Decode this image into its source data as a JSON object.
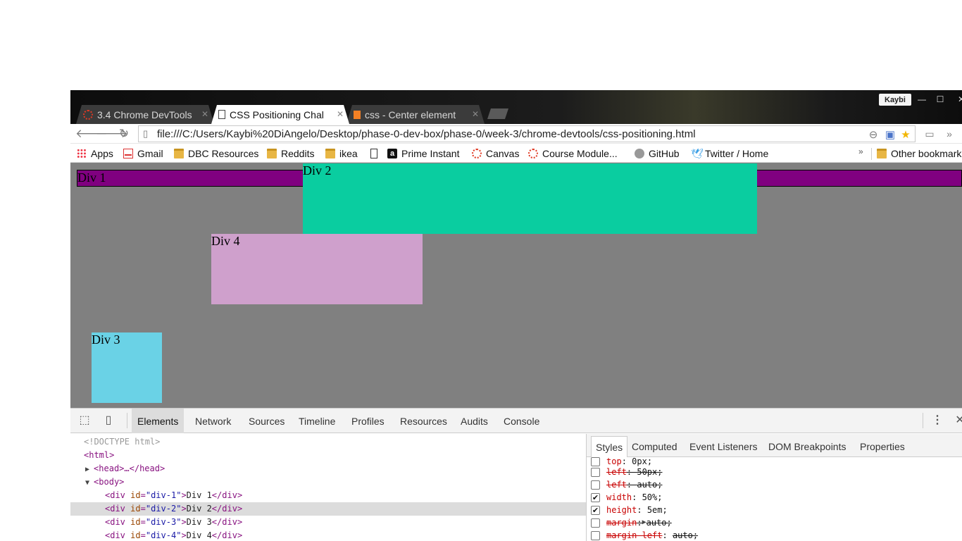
{
  "browser": {
    "tabs": [
      {
        "title": "3.4 Chrome DevTools",
        "icon": "dbc-icon",
        "active": false
      },
      {
        "title": "CSS Positioning Chal",
        "icon": "page-icon",
        "active": true
      },
      {
        "title": "css - Center element",
        "icon": "stackoverflow-icon",
        "active": false
      }
    ],
    "profile_name": "Kaybi",
    "window_controls": {
      "minimize": "—",
      "maximize": "☐",
      "close": "✕"
    },
    "address": {
      "url": "file:///C:/Users/Kaybi%20DiAngelo/Desktop/phase-0-dev-box/phase-0/week-3/chrome-devtools/css-positioning.html"
    },
    "nav": {
      "back": "🡐",
      "forward": "🡒",
      "reload": "↻",
      "more": "»"
    }
  },
  "bookmarks": {
    "items": [
      {
        "label": "Apps",
        "icon": "apps-icon"
      },
      {
        "label": "Gmail",
        "icon": "gmail-icon"
      },
      {
        "label": "DBC Resources",
        "icon": "folder-icon"
      },
      {
        "label": "Reddits",
        "icon": "folder-icon"
      },
      {
        "label": "ikea",
        "icon": "folder-icon"
      },
      {
        "label": "",
        "icon": "page-icon"
      },
      {
        "label": "Prime Instant",
        "icon": "amazon-icon"
      },
      {
        "label": "Canvas",
        "icon": "canvas-icon"
      },
      {
        "label": "Course Module...",
        "icon": "canvas-icon"
      },
      {
        "label": "GitHub",
        "icon": "github-icon"
      },
      {
        "label": "Twitter / Home",
        "icon": "twitter-icon"
      }
    ],
    "overflow": "»",
    "other": "Other bookmarks"
  },
  "page": {
    "div1": "Div 1",
    "div2": "Div 2",
    "div3": "Div 3",
    "div4": "Div 4"
  },
  "devtools": {
    "tabs": [
      "Elements",
      "Network",
      "Sources",
      "Timeline",
      "Profiles",
      "Resources",
      "Audits",
      "Console"
    ],
    "selected_tab": "Elements",
    "dom": [
      {
        "doctype": "<!DOCTYPE html>"
      },
      {
        "open": "<html>"
      },
      {
        "collapsed": "<head>…</head>"
      },
      {
        "open": "<body>"
      },
      {
        "tag": "div",
        "id": "div-1",
        "text": "Div 1"
      },
      {
        "tag": "div",
        "id": "div-2",
        "text": "Div 2",
        "selected": true
      },
      {
        "tag": "div",
        "id": "div-3",
        "text": "Div 3"
      },
      {
        "tag": "div",
        "id": "div-4",
        "text": "Div 4"
      }
    ],
    "styles_tabs": [
      "Styles",
      "Computed",
      "Event Listeners",
      "DOM Breakpoints",
      "Properties"
    ],
    "selected_styles_tab": "Styles",
    "style_props": [
      {
        "name": "top",
        "value": "0px;",
        "checked": false,
        "struck": false
      },
      {
        "name": "left",
        "value": "50px;",
        "checked": false,
        "struck": true
      },
      {
        "name": "left",
        "value": "auto;",
        "checked": false,
        "struck": true
      },
      {
        "name": "width",
        "value": "50%;",
        "checked": true,
        "struck": false
      },
      {
        "name": "height",
        "value": "5em;",
        "checked": true,
        "struck": false
      },
      {
        "name": "margin",
        "value": "auto;",
        "checked": false,
        "struck": true
      },
      {
        "name": "margin-left",
        "value": "auto;",
        "checked": false,
        "struck": true
      }
    ]
  }
}
